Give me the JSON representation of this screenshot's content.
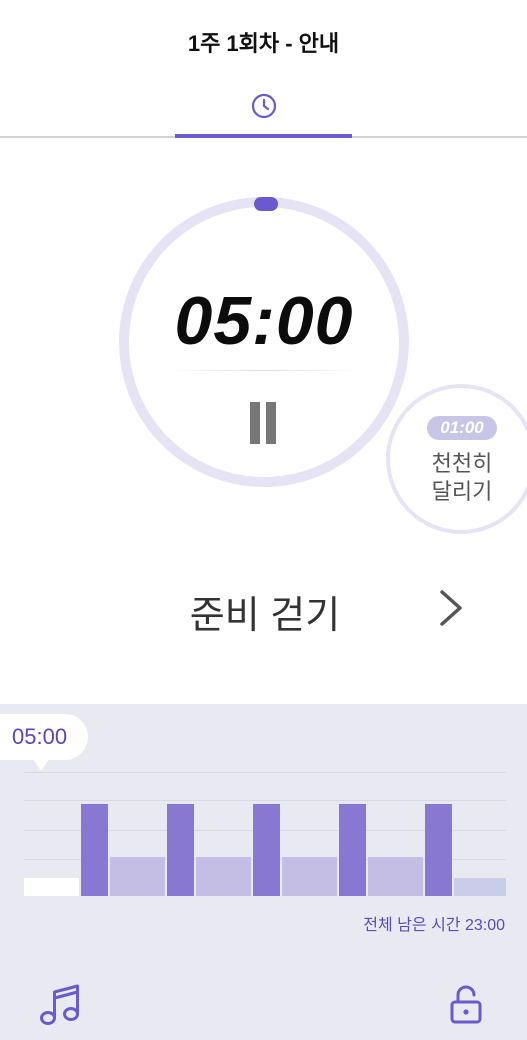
{
  "header": {
    "title": "1주 1회차 - 안내"
  },
  "tabs": [
    {
      "icon": "clock-icon",
      "active": true
    }
  ],
  "timer": {
    "current_time": "05:00",
    "ring_progress": 0.0
  },
  "next_segment": {
    "time": "01:00",
    "label_line1": "천천히",
    "label_line2": "달리기"
  },
  "phase": {
    "label": "준비 걷기"
  },
  "progress": {
    "tooltip_time": "05:00",
    "remaining_label": "전체 남은 시간 23:00",
    "segments": [
      {
        "kind": "warmup",
        "level": 0.2,
        "color": "#ffffff"
      },
      {
        "kind": "run",
        "level": 1.0,
        "color": "#8878d2"
      },
      {
        "kind": "walk",
        "level": 0.42,
        "color": "#c4bde4"
      },
      {
        "kind": "run",
        "level": 1.0,
        "color": "#8878d2"
      },
      {
        "kind": "walk",
        "level": 0.42,
        "color": "#c4bde4"
      },
      {
        "kind": "run",
        "level": 1.0,
        "color": "#8878d2"
      },
      {
        "kind": "walk",
        "level": 0.42,
        "color": "#c4bde4"
      },
      {
        "kind": "run",
        "level": 1.0,
        "color": "#8878d2"
      },
      {
        "kind": "walk",
        "level": 0.42,
        "color": "#c4bde4"
      },
      {
        "kind": "run",
        "level": 1.0,
        "color": "#8878d2"
      },
      {
        "kind": "cooldown",
        "level": 0.2,
        "color": "#c8cde9"
      }
    ]
  },
  "toolbar": {
    "music_icon": "music-note-icon",
    "lock_icon": "unlock-icon"
  },
  "colors": {
    "accent": "#6a5acd",
    "ring": "#e6e4f4",
    "panel": "#e9e9f1"
  }
}
